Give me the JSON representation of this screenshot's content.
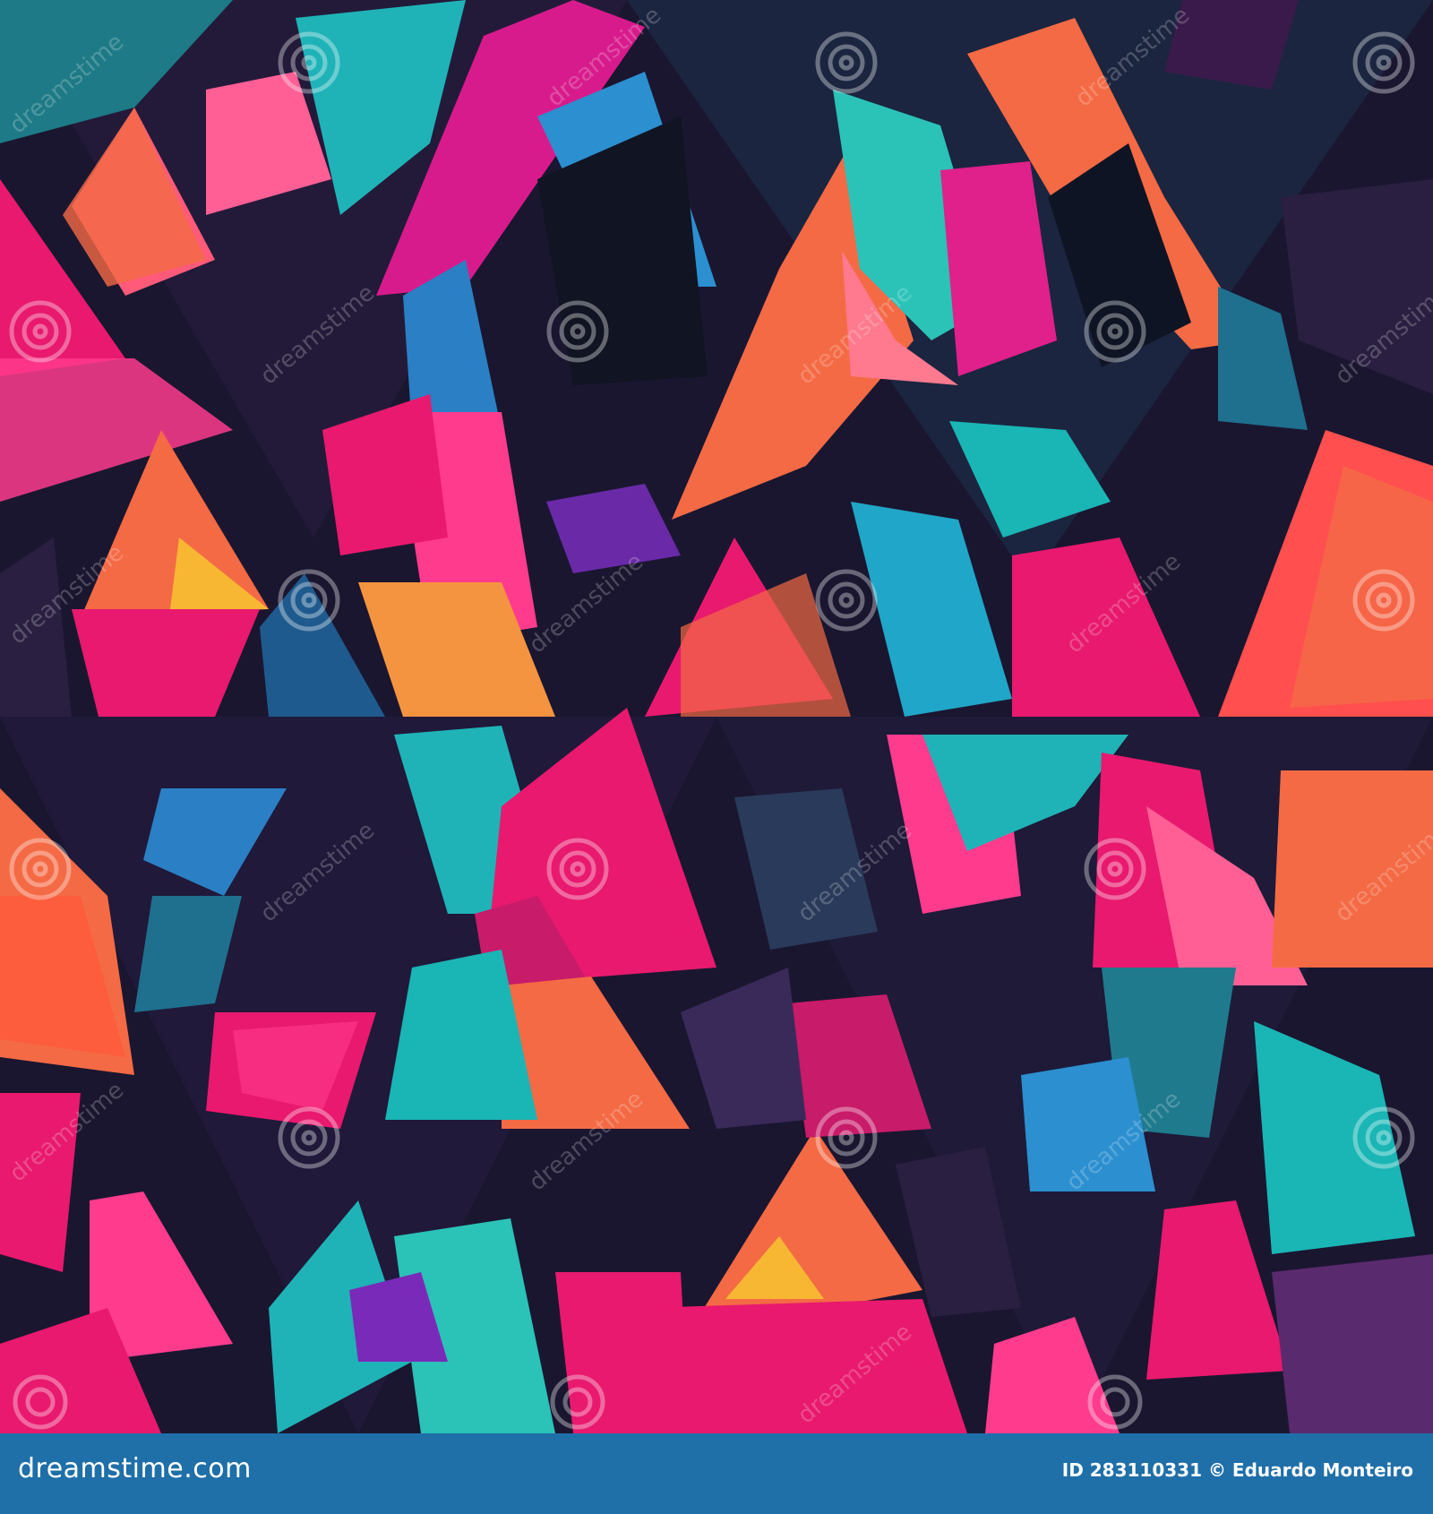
{
  "image": {
    "description_colors": {
      "background": "#1a1630",
      "magenta": "#e8196e",
      "pink": "#ff3b8e",
      "orange": "#f46a45",
      "teal": "#1fb3b8",
      "blue": "#2b7fc4",
      "purple": "#5a2a6e",
      "navy": "#16223a",
      "yellow": "#f7b733",
      "footer": "#1f6fa9"
    }
  },
  "watermark": {
    "text": "dreamstime",
    "icon": "spiral-logo-icon"
  },
  "footer": {
    "site": "dreamstime.com",
    "credit": "ID 283110331 © Eduardo Monteiro"
  }
}
